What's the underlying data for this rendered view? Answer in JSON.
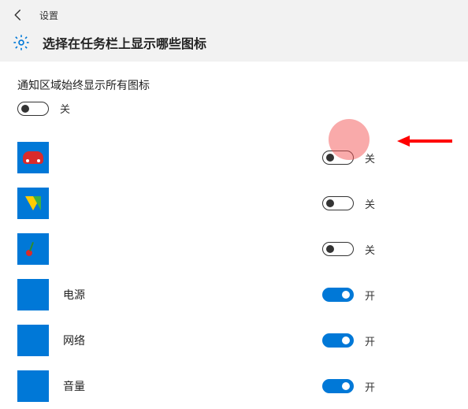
{
  "header": {
    "settings_label": "设置",
    "page_title": "选择在任务栏上显示哪些图标"
  },
  "master": {
    "label": "通知区域始终显示所有图标",
    "state_label": "关",
    "on": false
  },
  "state_labels": {
    "on": "开",
    "off": "关"
  },
  "items": [
    {
      "name": "",
      "icon": "car-icon",
      "on": false,
      "state_label": "关"
    },
    {
      "name": "",
      "icon": "shield-icon",
      "on": false,
      "state_label": "关"
    },
    {
      "name": "",
      "icon": "cherry-icon",
      "on": false,
      "state_label": "关"
    },
    {
      "name": "电源",
      "icon": "blank-icon",
      "on": true,
      "state_label": "开"
    },
    {
      "name": "网络",
      "icon": "blank-icon",
      "on": true,
      "state_label": "开"
    },
    {
      "name": "音量",
      "icon": "blank-icon",
      "on": true,
      "state_label": "开"
    }
  ]
}
